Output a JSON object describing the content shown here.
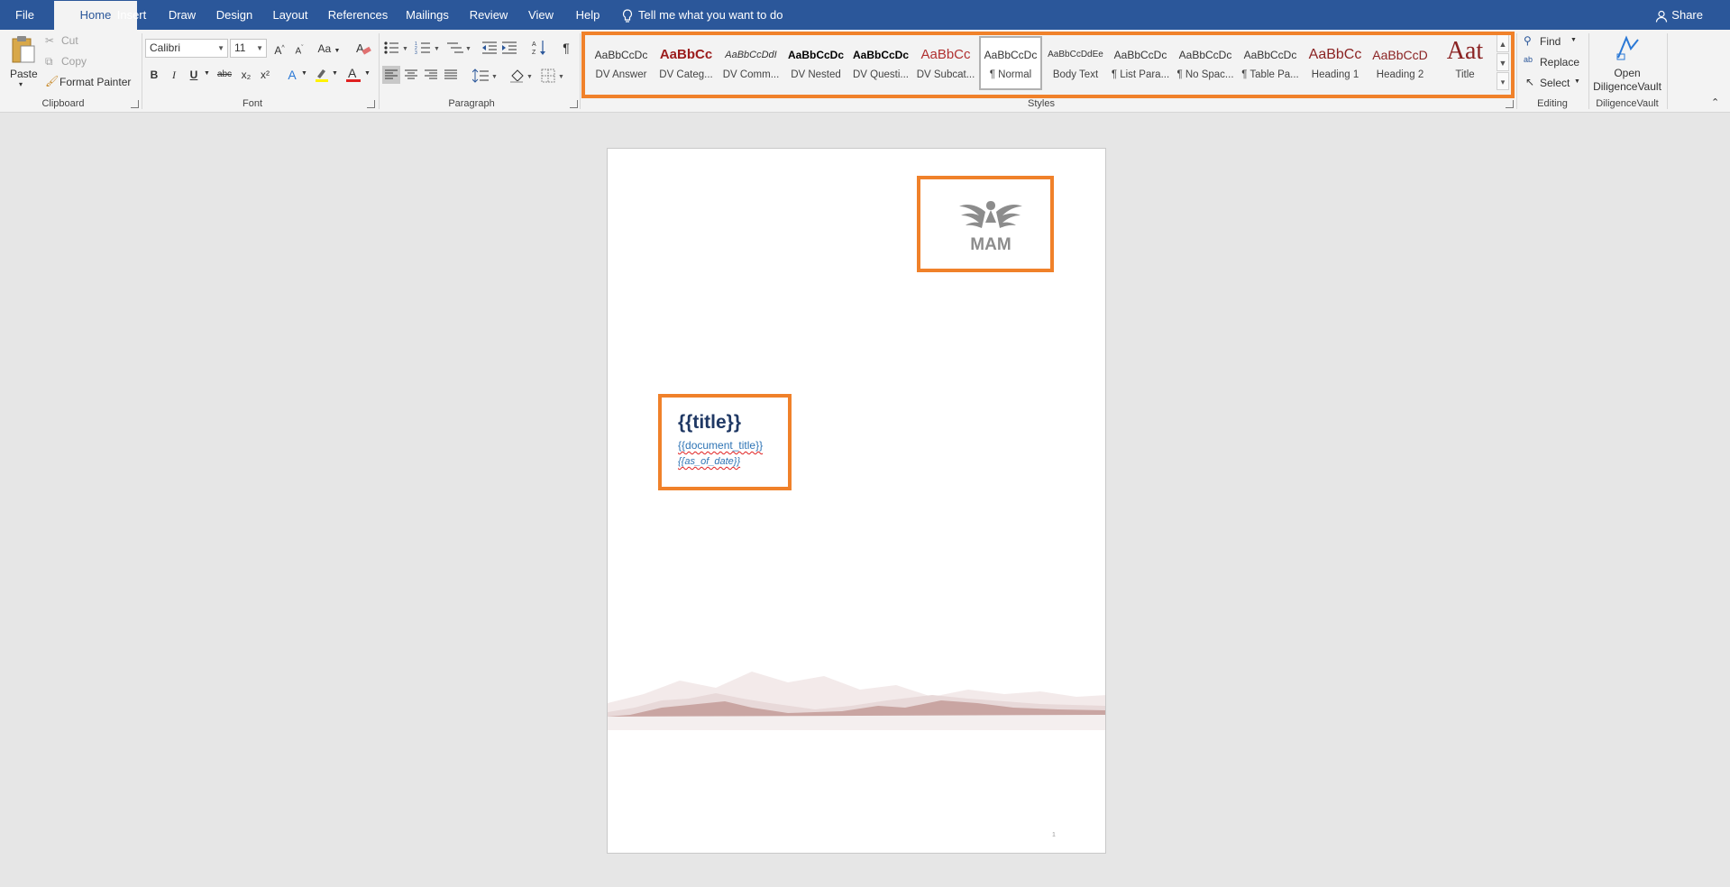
{
  "menubar": {
    "tabs": [
      "File",
      "Home",
      "Insert",
      "Draw",
      "Design",
      "Layout",
      "References",
      "Mailings",
      "Review",
      "View",
      "Help"
    ],
    "active_tab": "Home",
    "tell_me": "Tell me what you want to do",
    "share": "Share"
  },
  "clipboard": {
    "paste": "Paste",
    "cut": "Cut",
    "copy": "Copy",
    "format_painter": "Format Painter",
    "label": "Clipboard"
  },
  "font": {
    "family": "Calibri",
    "size": "11",
    "grow": "A",
    "shrink": "A",
    "case": "Aa",
    "bold": "B",
    "italic": "I",
    "underline": "U",
    "strikethrough": "abc",
    "subscript": "x₂",
    "superscript": "x²",
    "text_effects": "A",
    "font_color": "A",
    "label": "Font"
  },
  "paragraph": {
    "show_marks": "¶",
    "label": "Paragraph"
  },
  "styles": {
    "label": "Styles",
    "selected": "¶ Normal",
    "items": [
      {
        "sample": "AaBbCcDc",
        "name": "DV Answer",
        "color": "#333333"
      },
      {
        "sample": "AaBbCc",
        "name": "DV Categ...",
        "color": "#9b1c1c"
      },
      {
        "sample": "AaBbCcDdI",
        "name": "DV Comm...",
        "color": "#333333"
      },
      {
        "sample": "AaBbCcDc",
        "name": "DV Nested",
        "color": "#000000"
      },
      {
        "sample": "AaBbCcDc",
        "name": "DV Questi...",
        "color": "#000000"
      },
      {
        "sample": "AaBbCc",
        "name": "DV Subcat...",
        "color": "#b03030"
      },
      {
        "sample": "AaBbCcDc",
        "name": "¶ Normal",
        "color": "#333333"
      },
      {
        "sample": "AaBbCcDdEe",
        "name": "Body Text",
        "color": "#333333"
      },
      {
        "sample": "AaBbCcDc",
        "name": "¶ List Para...",
        "color": "#333333"
      },
      {
        "sample": "AaBbCcDc",
        "name": "¶ No Spac...",
        "color": "#333333"
      },
      {
        "sample": "AaBbCcDc",
        "name": "¶ Table Pa...",
        "color": "#333333"
      },
      {
        "sample": "AaBbCc",
        "name": "Heading 1",
        "color": "#8b2323"
      },
      {
        "sample": "AaBbCcD",
        "name": "Heading 2",
        "color": "#8b2323"
      },
      {
        "sample": "Aat",
        "name": "Title",
        "color": "#8b2323"
      }
    ]
  },
  "editing": {
    "find": "Find",
    "replace": "Replace",
    "select": "Select",
    "label": "Editing"
  },
  "diligencevault": {
    "button_line1": "Open",
    "button_line2": "DiligenceVault",
    "label": "DiligenceVault"
  },
  "document": {
    "logo_text": "MAM",
    "title": "{{title}}",
    "document_title": "{{document_title}}",
    "as_of_date": "{{as_of_date}}",
    "page_number": "1"
  },
  "colors": {
    "ribbon_blue": "#2b579a",
    "highlight_orange": "#f0812a",
    "title_navy": "#1f3864",
    "placeholder_blue": "#2e74b5"
  }
}
